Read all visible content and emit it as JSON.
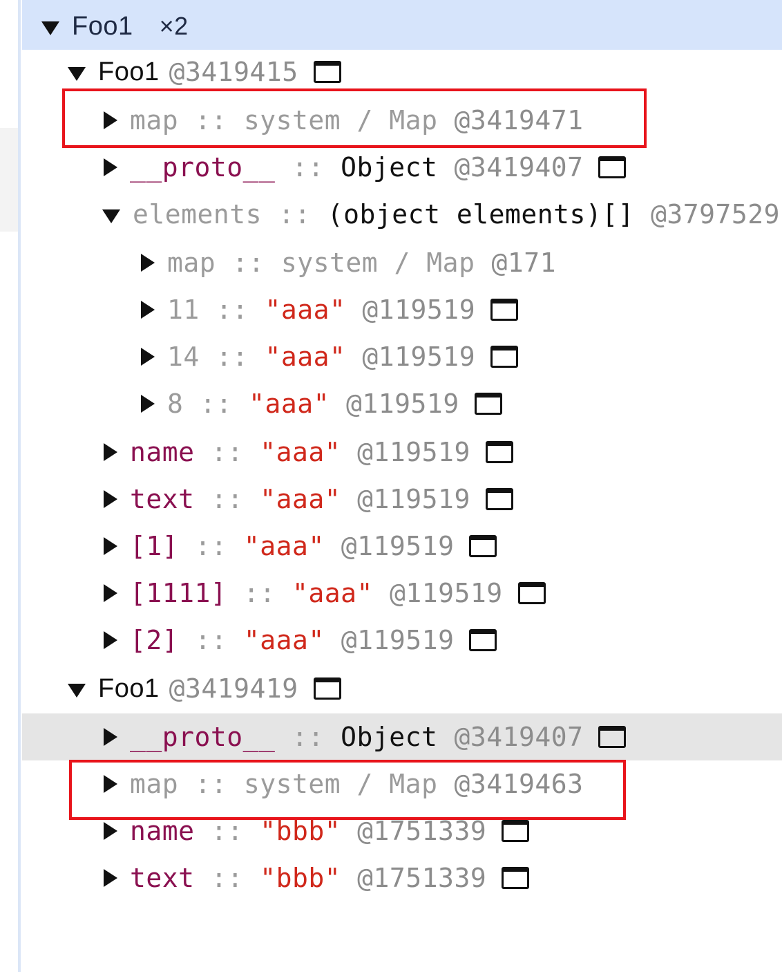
{
  "group": {
    "name": "Foo1",
    "count": "×2"
  },
  "objects": [
    {
      "class": "Foo1",
      "id": "@3419415",
      "props": [
        {
          "key": "map",
          "key_style": "weak",
          "sep": "::",
          "value": "system / Map",
          "value_style": "weak",
          "id": "@3419471",
          "icon": false
        },
        {
          "key": "__proto__",
          "key_style": "key",
          "sep": "::",
          "value": "Object",
          "value_style": "type",
          "id": "@3419407",
          "icon": true
        },
        {
          "key": "elements",
          "key_style": "weak",
          "sep": "::",
          "value": "(object elements)[]",
          "value_style": "type",
          "id": "@3797529",
          "icon": false,
          "expanded": true
        }
      ],
      "elements": [
        {
          "key": "map",
          "sep": "::",
          "value": "system / Map",
          "value_style": "weak",
          "id": "@171",
          "icon": false
        },
        {
          "key": "11",
          "sep": "::",
          "value": "\"aaa\"",
          "value_style": "str",
          "id": "@119519",
          "icon": true
        },
        {
          "key": "14",
          "sep": "::",
          "value": "\"aaa\"",
          "value_style": "str",
          "id": "@119519",
          "icon": true
        },
        {
          "key": "8",
          "sep": "::",
          "value": "\"aaa\"",
          "value_style": "str",
          "id": "@119519",
          "icon": true
        }
      ],
      "props_after": [
        {
          "key": "name",
          "sep": "::",
          "value": "\"aaa\"",
          "id": "@119519"
        },
        {
          "key": "text",
          "sep": "::",
          "value": "\"aaa\"",
          "id": "@119519"
        },
        {
          "key": "[1]",
          "sep": "::",
          "value": "\"aaa\"",
          "id": "@119519"
        },
        {
          "key": "[1111]",
          "sep": "::",
          "value": "\"aaa\"",
          "id": "@119519"
        },
        {
          "key": "[2]",
          "sep": "::",
          "value": "\"aaa\"",
          "id": "@119519"
        }
      ]
    },
    {
      "class": "Foo1",
      "id": "@3419419",
      "props": [
        {
          "key": "__proto__",
          "sep": "::",
          "value": "Object",
          "id": "@3419407",
          "icon": true,
          "selected": true
        },
        {
          "key": "map",
          "sep": "::",
          "value": "system / Map",
          "id": "@3419463",
          "icon": false
        },
        {
          "key": "name",
          "sep": "::",
          "value": "\"bbb\"",
          "id": "@1751339",
          "icon": true
        },
        {
          "key": "text",
          "sep": "::",
          "value": "\"bbb\"",
          "id": "@1751339",
          "icon": true
        }
      ]
    }
  ],
  "annotation_color": "#e8141b",
  "selection_color": "#e5e5e5",
  "header_color": "#d6e4fb"
}
